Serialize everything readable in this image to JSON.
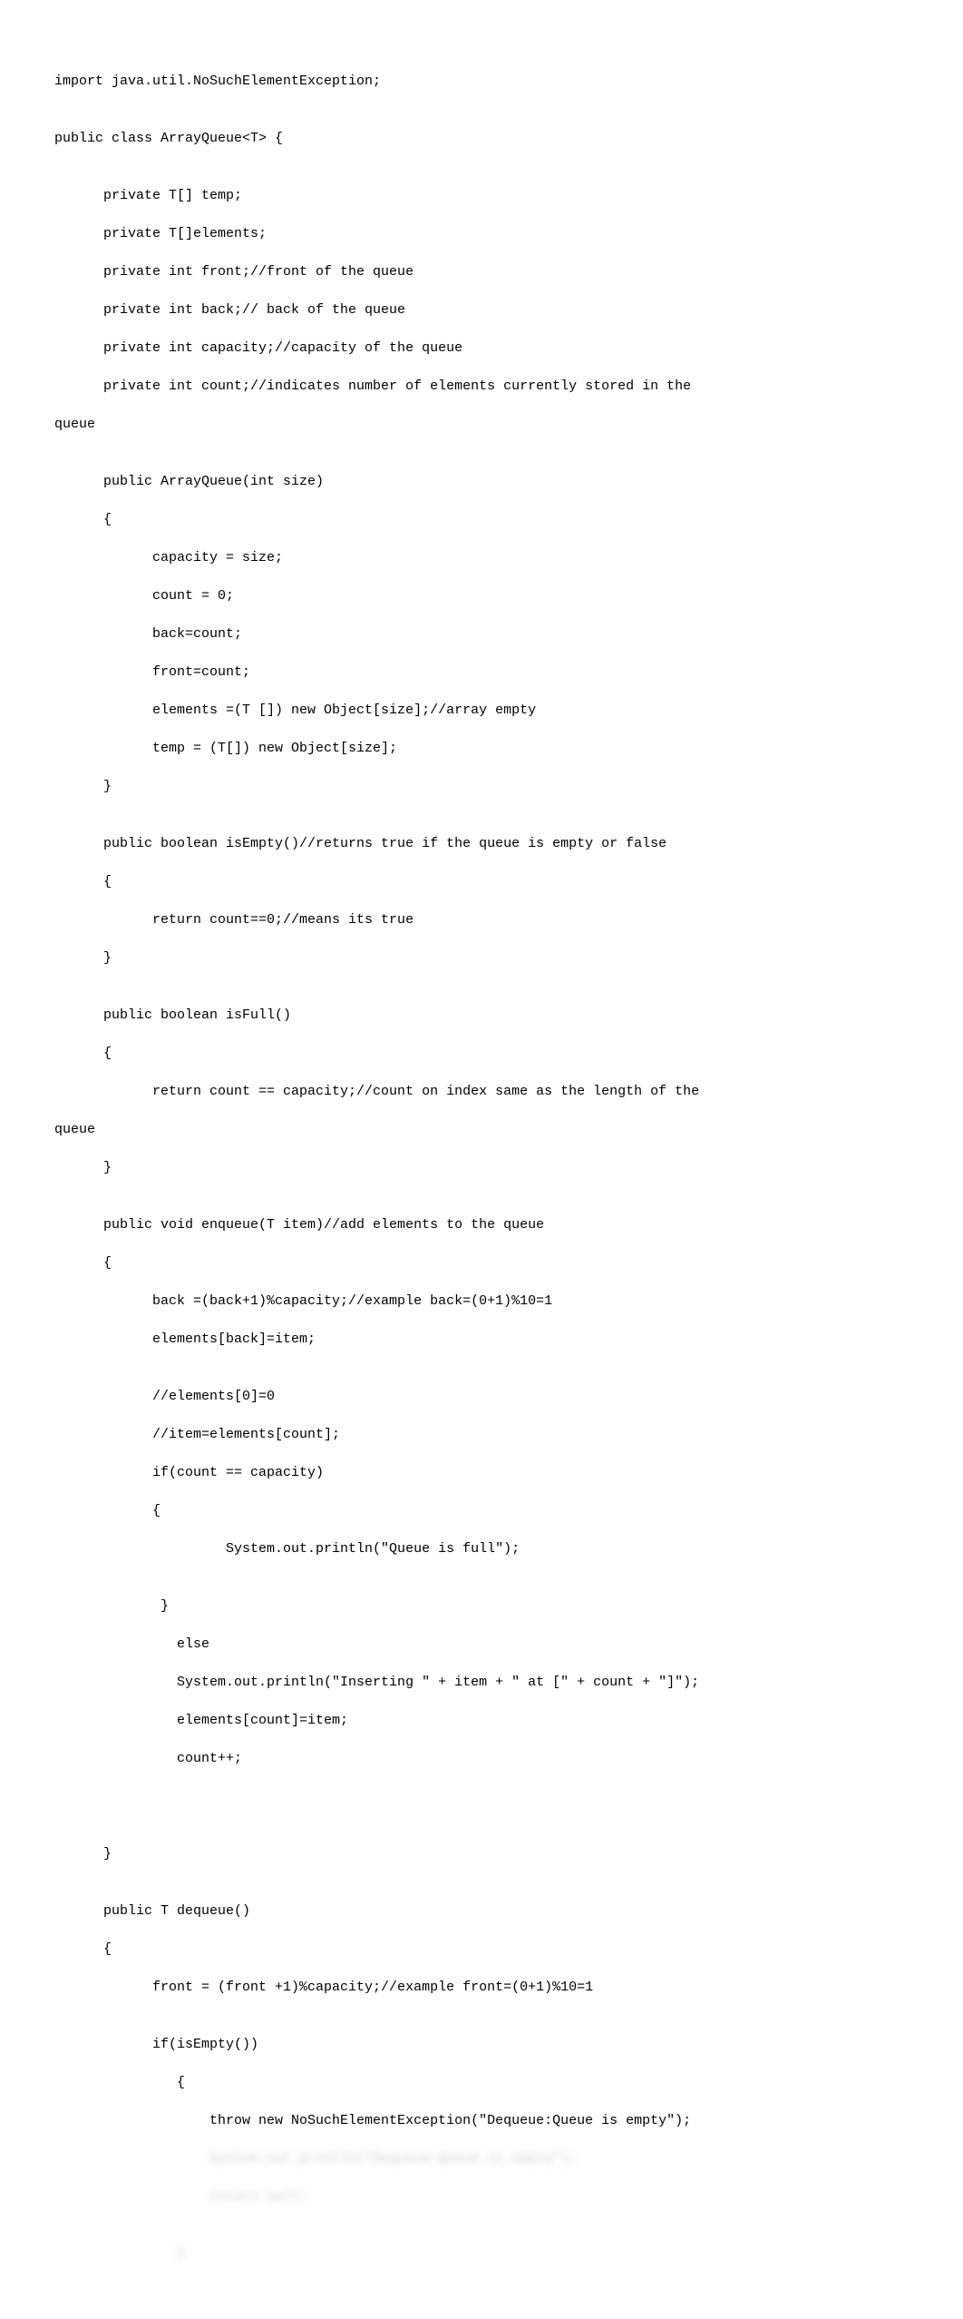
{
  "code": {
    "lines": [
      "import java.util.NoSuchElementException;",
      "",
      "public class ArrayQueue<T> {",
      "",
      "      private T[] temp;",
      "      private T[]elements;",
      "      private int front;//front of the queue",
      "      private int back;// back of the queue",
      "      private int capacity;//capacity of the queue",
      "      private int count;//indicates number of elements currently stored in the",
      "queue",
      "",
      "      public ArrayQueue(int size)",
      "      {",
      "            capacity = size;",
      "            count = 0;",
      "            back=count;",
      "            front=count;",
      "            elements =(T []) new Object[size];//array empty",
      "            temp = (T[]) new Object[size];",
      "      }",
      "",
      "      public boolean isEmpty()//returns true if the queue is empty or false",
      "      {",
      "            return count==0;//means its true",
      "      }",
      "",
      "      public boolean isFull()",
      "      {",
      "            return count == capacity;//count on index same as the length of the",
      "queue",
      "      }",
      "",
      "      public void enqueue(T item)//add elements to the queue",
      "      {",
      "            back =(back+1)%capacity;//example back=(0+1)%10=1",
      "            elements[back]=item;",
      "",
      "            //elements[0]=0",
      "            //item=elements[count];",
      "            if(count == capacity)",
      "            {",
      "                     System.out.println(\"Queue is full\");",
      "",
      "             }",
      "               else",
      "               System.out.println(\"Inserting \" + item + \" at [\" + count + \"]\");",
      "               elements[count]=item;",
      "               count++;",
      "",
      "",
      "",
      "      }",
      "",
      "      public T dequeue()",
      "      {",
      "            front = (front +1)%capacity;//example front=(0+1)%10=1",
      "",
      "            if(isEmpty())",
      "               {",
      "                   throw new NoSuchElementException(\"Dequeue:Queue is empty\");"
    ],
    "blurred_lines": [
      "                   System.out.println(\"Dequeue:Queue is empty\");",
      "                   return null;",
      "",
      "               }"
    ]
  }
}
